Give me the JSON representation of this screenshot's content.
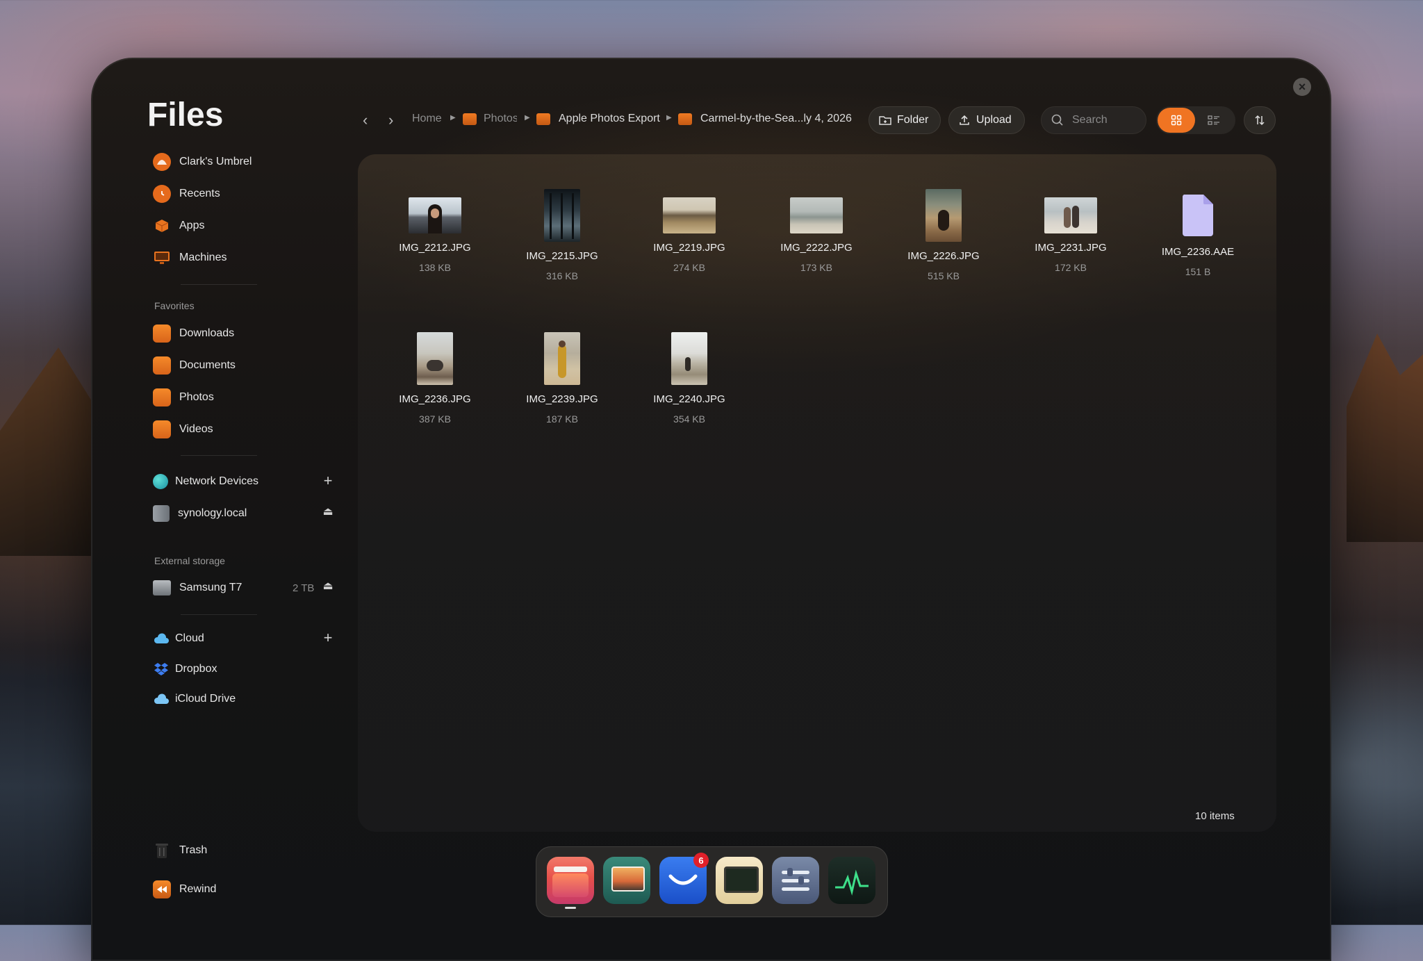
{
  "app": {
    "title": "Files"
  },
  "sidebar": {
    "top_items": [
      {
        "label": "Clark's Umbrel",
        "icon": "umbrel-icon"
      },
      {
        "label": "Recents",
        "icon": "clock-icon"
      },
      {
        "label": "Apps",
        "icon": "box-icon"
      },
      {
        "label": "Machines",
        "icon": "monitor-icon"
      }
    ],
    "favorites_label": "Favorites",
    "favorites": [
      {
        "label": "Downloads",
        "icon": "folder-icon"
      },
      {
        "label": "Documents",
        "icon": "folder-icon"
      },
      {
        "label": "Photos",
        "icon": "folder-icon"
      },
      {
        "label": "Videos",
        "icon": "folder-icon"
      }
    ],
    "network": {
      "label": "Network Devices",
      "add": "+"
    },
    "network_items": [
      {
        "label": "synology.local",
        "eject": "⏏"
      }
    ],
    "external_label": "External storage",
    "external_items": [
      {
        "label": "Samsung T7",
        "size": "2 TB",
        "eject": "⏏"
      }
    ],
    "cloud": {
      "label": "Cloud",
      "add": "+"
    },
    "cloud_items": [
      {
        "label": "Dropbox"
      },
      {
        "label": "iCloud Drive"
      }
    ],
    "trash": "Trash",
    "rewind": "Rewind"
  },
  "toolbar": {
    "back": "‹",
    "forward": "›",
    "breadcrumb": [
      "Home",
      "Photos",
      "Apple Photos Export",
      "Carmel-by-the-Sea...ly 4, 2026"
    ],
    "folder_button": "Folder",
    "upload_button": "Upload",
    "search_placeholder": "Search",
    "view_mode": "grid",
    "accent_color": "#f07422"
  },
  "files": [
    {
      "name": "IMG_2212.JPG",
      "size": "138 KB"
    },
    {
      "name": "IMG_2215.JPG",
      "size": "316 KB"
    },
    {
      "name": "IMG_2219.JPG",
      "size": "274 KB"
    },
    {
      "name": "IMG_2222.JPG",
      "size": "173 KB"
    },
    {
      "name": "IMG_2226.JPG",
      "size": "515 KB"
    },
    {
      "name": "IMG_2231.JPG",
      "size": "172 KB"
    },
    {
      "name": "IMG_2236.AAE",
      "size": "151 B"
    },
    {
      "name": "IMG_2236.JPG",
      "size": "387 KB"
    },
    {
      "name": "IMG_2239.JPG",
      "size": "187 KB"
    },
    {
      "name": "IMG_2240.JPG",
      "size": "354 KB"
    }
  ],
  "status": {
    "items_count": "10 items"
  },
  "dock": {
    "apps": [
      "files-app",
      "photos-app",
      "mail-app",
      "monitor-app",
      "settings-app",
      "activity-app"
    ],
    "mail_badge": "6"
  },
  "window": {
    "close": "×"
  }
}
